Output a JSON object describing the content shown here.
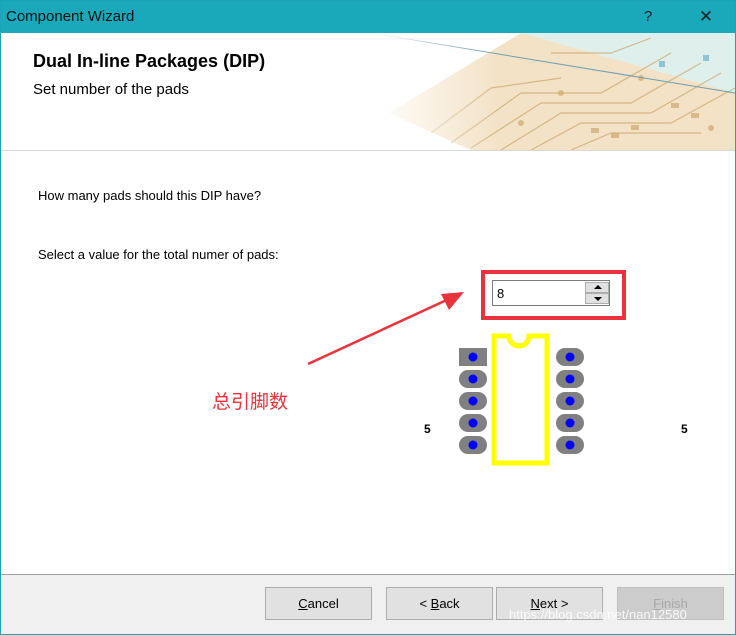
{
  "window": {
    "title": "Component Wizard",
    "help_label": "?",
    "close_label": "✕"
  },
  "header": {
    "title": "Dual In-line Packages (DIP)",
    "subtitle": "Set number of the pads"
  },
  "main": {
    "question": "How many pads should this DIP have?",
    "prompt": "Select a value for the total numer of pads:",
    "pad_count": "8",
    "annotation": "总引脚数",
    "side_label_left": "5",
    "side_label_right": "5"
  },
  "buttons": {
    "cancel": {
      "mnemonic": "C",
      "rest": "ancel"
    },
    "back": {
      "prefix": "< ",
      "mnemonic": "B",
      "rest": "ack"
    },
    "next": {
      "mnemonic": "N",
      "rest": "ext >"
    },
    "finish": {
      "mnemonic": "F",
      "rest": "inish"
    }
  },
  "watermark": "https://blog.csdn.net/nan12580",
  "colors": {
    "titlebar": "#1aa8bb",
    "highlight": "#e8323c",
    "pad": "#808080",
    "pad_center": "#0000ff",
    "body_outline": "#ffff00"
  }
}
